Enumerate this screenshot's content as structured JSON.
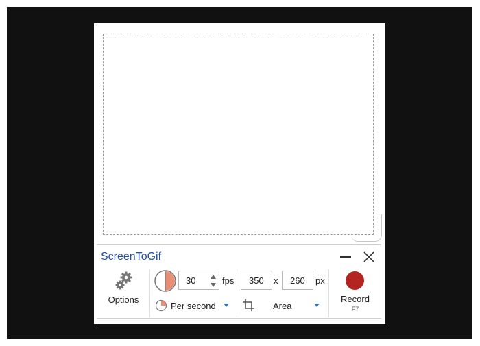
{
  "app": {
    "title": "ScreenToGif"
  },
  "window_controls": {
    "minimize": "minimize-icon",
    "close": "close-icon"
  },
  "options": {
    "label": "Options",
    "icon": "gear-icon"
  },
  "framerate": {
    "value": "30",
    "unit": "fps",
    "mode": "Per second"
  },
  "size": {
    "width": "350",
    "separator": "x",
    "height": "260",
    "unit": "px"
  },
  "region": {
    "mode": "Area",
    "icon": "crop-icon"
  },
  "record": {
    "label": "Record",
    "shortcut": "F7",
    "color": "#b42522"
  },
  "colors": {
    "accent": "#1f4fa3",
    "dropdown_arrow": "#2f7bc4",
    "fps_icon": "#e98d74"
  }
}
